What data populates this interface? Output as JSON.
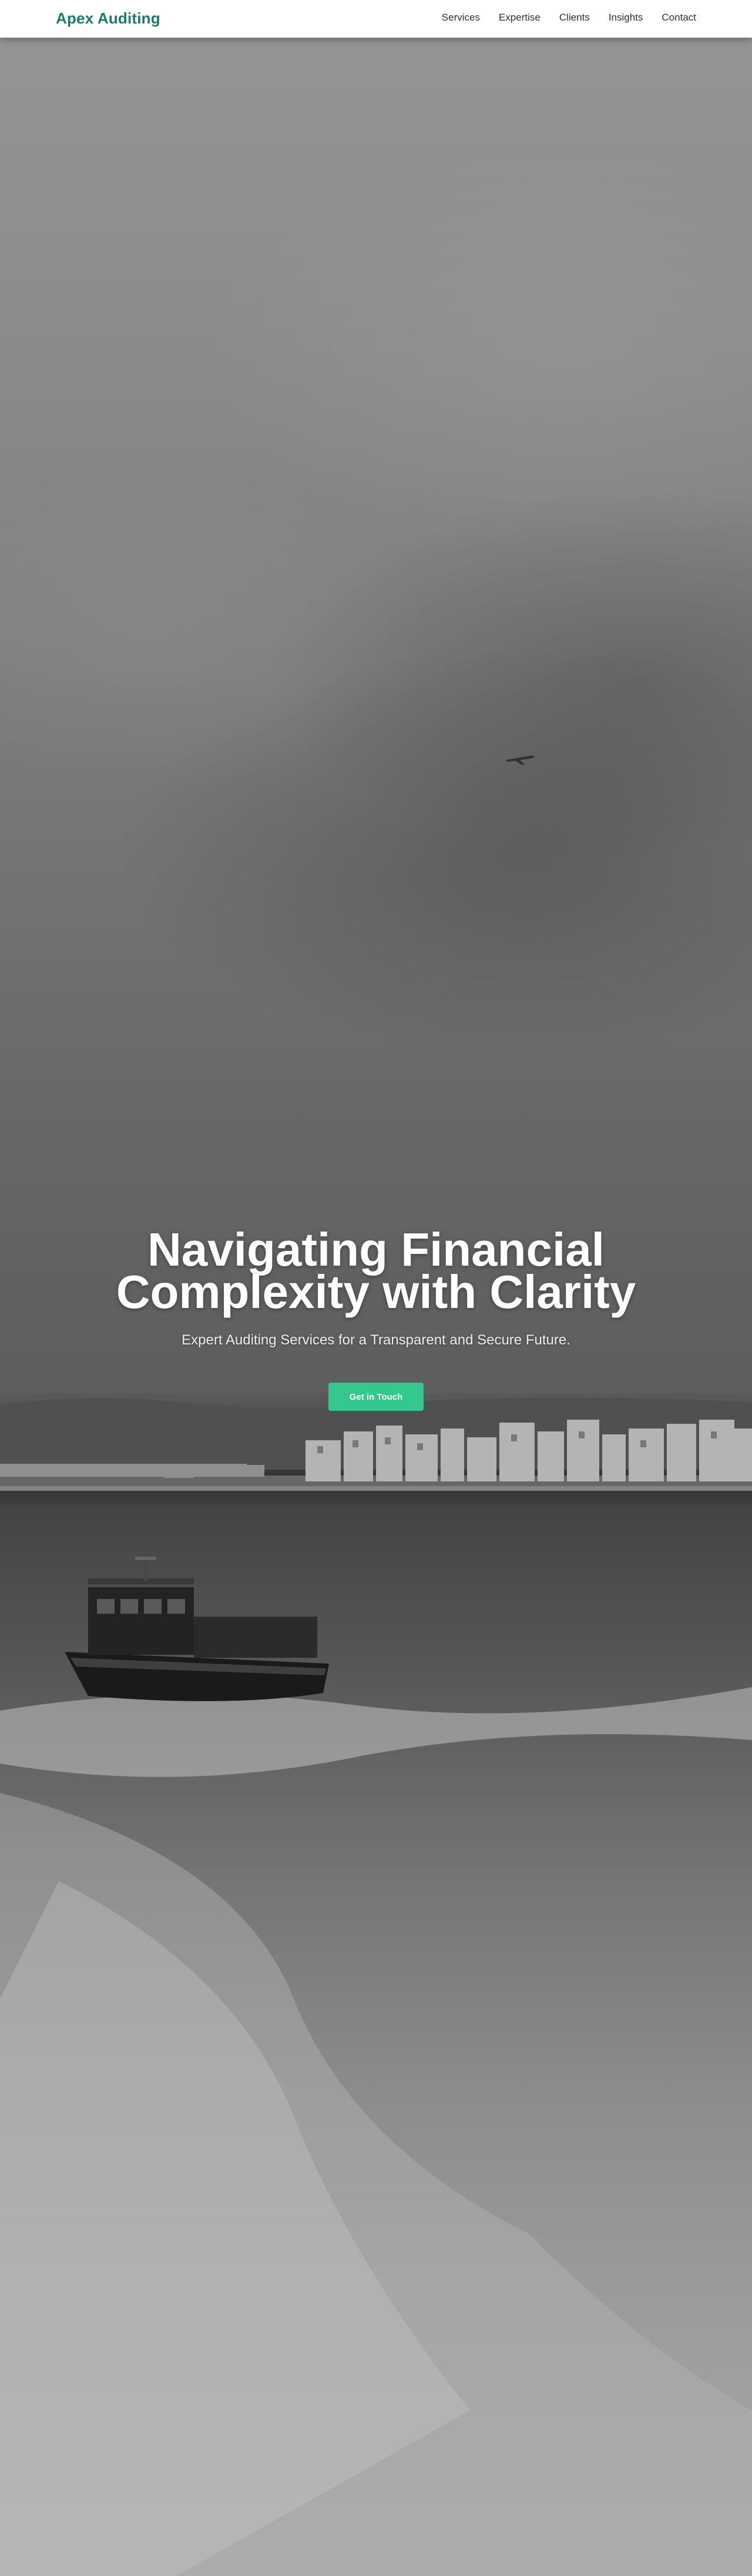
{
  "header": {
    "brand": "Apex Auditing",
    "brand_color": "#1e7a64",
    "nav": [
      {
        "label": "Services"
      },
      {
        "label": "Expertise"
      },
      {
        "label": "Clients"
      },
      {
        "label": "Insights"
      },
      {
        "label": "Contact"
      }
    ]
  },
  "hero": {
    "title": "Navigating Financial Complexity with Clarity",
    "subtitle": "Expert Auditing Services for a Transparent and Secure Future.",
    "cta_label": "Get in Touch",
    "cta_color": "#34c88e",
    "background_image": "grayscale photo: stormy sky, city waterfront, boat with white wake"
  }
}
